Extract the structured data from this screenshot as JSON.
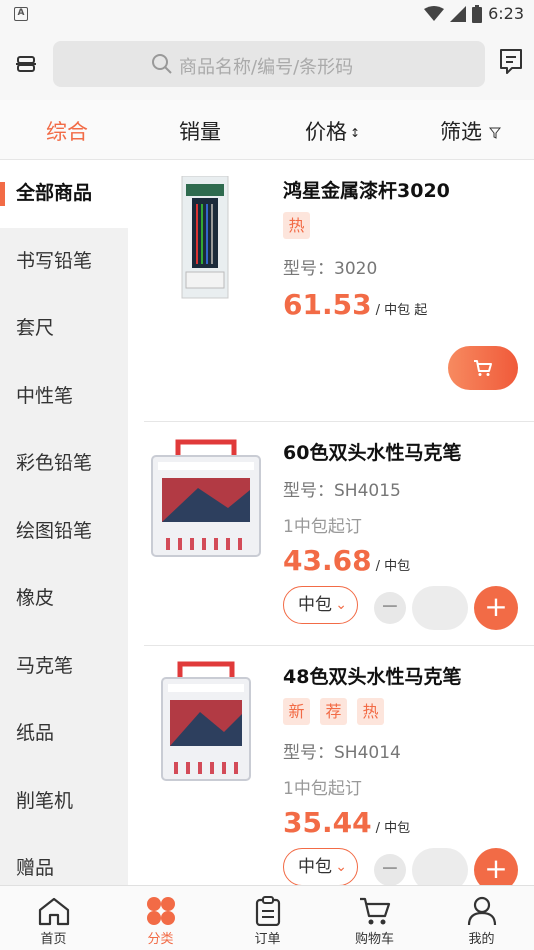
{
  "status": {
    "time": "6:23",
    "left_icon": "A"
  },
  "search": {
    "placeholder": "商品名称/编号/条形码"
  },
  "sort": {
    "items": [
      "综合",
      "销量",
      "价格",
      "筛选"
    ],
    "price_arrows": "↕",
    "filter_icon": "filter-icon"
  },
  "categories": [
    "全部商品",
    "书写铅笔",
    "套尺",
    "中性笔",
    "彩色铅笔",
    "绘图铅笔",
    "橡皮",
    "马克笔",
    "纸品",
    "削笔机",
    "赠品"
  ],
  "products": [
    {
      "title": "鸿星金属漆杆3020",
      "tags": [
        "热"
      ],
      "model": "型号：3020",
      "price": "61.53",
      "unit_text": "/ 中包 起"
    },
    {
      "title": "60色双头水性马克笔",
      "model": "型号：SH4015",
      "min_order": "1中包起订",
      "price": "43.68",
      "unit_text": "/ 中包",
      "unit_select": "中包"
    },
    {
      "title": "48色双头水性马克笔",
      "tags": [
        "新",
        "荐",
        "热"
      ],
      "model": "型号：SH4014",
      "min_order": "1中包起订",
      "price": "35.44",
      "unit_text": "/ 中包",
      "unit_select": "中包"
    }
  ],
  "tabs": [
    "首页",
    "分类",
    "订单",
    "购物车",
    "我的"
  ],
  "colors": {
    "accent": "#f26b46",
    "tag_bg": "#fde5dc"
  }
}
